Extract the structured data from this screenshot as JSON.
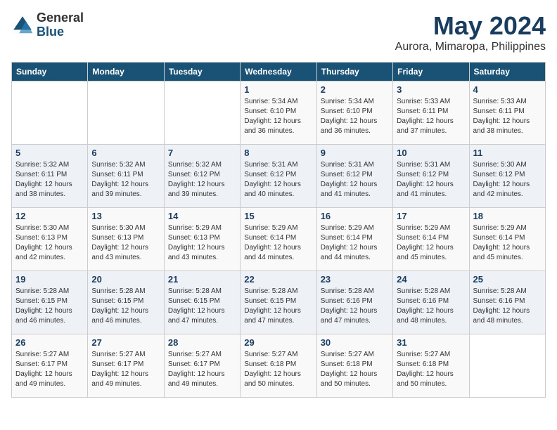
{
  "header": {
    "logo_general": "General",
    "logo_blue": "Blue",
    "title": "May 2024",
    "location": "Aurora, Mimaropa, Philippines"
  },
  "calendar": {
    "days_of_week": [
      "Sunday",
      "Monday",
      "Tuesday",
      "Wednesday",
      "Thursday",
      "Friday",
      "Saturday"
    ],
    "weeks": [
      [
        {
          "day": "",
          "info": ""
        },
        {
          "day": "",
          "info": ""
        },
        {
          "day": "",
          "info": ""
        },
        {
          "day": "1",
          "info": "Sunrise: 5:34 AM\nSunset: 6:10 PM\nDaylight: 12 hours\nand 36 minutes."
        },
        {
          "day": "2",
          "info": "Sunrise: 5:34 AM\nSunset: 6:10 PM\nDaylight: 12 hours\nand 36 minutes."
        },
        {
          "day": "3",
          "info": "Sunrise: 5:33 AM\nSunset: 6:11 PM\nDaylight: 12 hours\nand 37 minutes."
        },
        {
          "day": "4",
          "info": "Sunrise: 5:33 AM\nSunset: 6:11 PM\nDaylight: 12 hours\nand 38 minutes."
        }
      ],
      [
        {
          "day": "5",
          "info": "Sunrise: 5:32 AM\nSunset: 6:11 PM\nDaylight: 12 hours\nand 38 minutes."
        },
        {
          "day": "6",
          "info": "Sunrise: 5:32 AM\nSunset: 6:11 PM\nDaylight: 12 hours\nand 39 minutes."
        },
        {
          "day": "7",
          "info": "Sunrise: 5:32 AM\nSunset: 6:12 PM\nDaylight: 12 hours\nand 39 minutes."
        },
        {
          "day": "8",
          "info": "Sunrise: 5:31 AM\nSunset: 6:12 PM\nDaylight: 12 hours\nand 40 minutes."
        },
        {
          "day": "9",
          "info": "Sunrise: 5:31 AM\nSunset: 6:12 PM\nDaylight: 12 hours\nand 41 minutes."
        },
        {
          "day": "10",
          "info": "Sunrise: 5:31 AM\nSunset: 6:12 PM\nDaylight: 12 hours\nand 41 minutes."
        },
        {
          "day": "11",
          "info": "Sunrise: 5:30 AM\nSunset: 6:12 PM\nDaylight: 12 hours\nand 42 minutes."
        }
      ],
      [
        {
          "day": "12",
          "info": "Sunrise: 5:30 AM\nSunset: 6:13 PM\nDaylight: 12 hours\nand 42 minutes."
        },
        {
          "day": "13",
          "info": "Sunrise: 5:30 AM\nSunset: 6:13 PM\nDaylight: 12 hours\nand 43 minutes."
        },
        {
          "day": "14",
          "info": "Sunrise: 5:29 AM\nSunset: 6:13 PM\nDaylight: 12 hours\nand 43 minutes."
        },
        {
          "day": "15",
          "info": "Sunrise: 5:29 AM\nSunset: 6:14 PM\nDaylight: 12 hours\nand 44 minutes."
        },
        {
          "day": "16",
          "info": "Sunrise: 5:29 AM\nSunset: 6:14 PM\nDaylight: 12 hours\nand 44 minutes."
        },
        {
          "day": "17",
          "info": "Sunrise: 5:29 AM\nSunset: 6:14 PM\nDaylight: 12 hours\nand 45 minutes."
        },
        {
          "day": "18",
          "info": "Sunrise: 5:29 AM\nSunset: 6:14 PM\nDaylight: 12 hours\nand 45 minutes."
        }
      ],
      [
        {
          "day": "19",
          "info": "Sunrise: 5:28 AM\nSunset: 6:15 PM\nDaylight: 12 hours\nand 46 minutes."
        },
        {
          "day": "20",
          "info": "Sunrise: 5:28 AM\nSunset: 6:15 PM\nDaylight: 12 hours\nand 46 minutes."
        },
        {
          "day": "21",
          "info": "Sunrise: 5:28 AM\nSunset: 6:15 PM\nDaylight: 12 hours\nand 47 minutes."
        },
        {
          "day": "22",
          "info": "Sunrise: 5:28 AM\nSunset: 6:15 PM\nDaylight: 12 hours\nand 47 minutes."
        },
        {
          "day": "23",
          "info": "Sunrise: 5:28 AM\nSunset: 6:16 PM\nDaylight: 12 hours\nand 47 minutes."
        },
        {
          "day": "24",
          "info": "Sunrise: 5:28 AM\nSunset: 6:16 PM\nDaylight: 12 hours\nand 48 minutes."
        },
        {
          "day": "25",
          "info": "Sunrise: 5:28 AM\nSunset: 6:16 PM\nDaylight: 12 hours\nand 48 minutes."
        }
      ],
      [
        {
          "day": "26",
          "info": "Sunrise: 5:27 AM\nSunset: 6:17 PM\nDaylight: 12 hours\nand 49 minutes."
        },
        {
          "day": "27",
          "info": "Sunrise: 5:27 AM\nSunset: 6:17 PM\nDaylight: 12 hours\nand 49 minutes."
        },
        {
          "day": "28",
          "info": "Sunrise: 5:27 AM\nSunset: 6:17 PM\nDaylight: 12 hours\nand 49 minutes."
        },
        {
          "day": "29",
          "info": "Sunrise: 5:27 AM\nSunset: 6:18 PM\nDaylight: 12 hours\nand 50 minutes."
        },
        {
          "day": "30",
          "info": "Sunrise: 5:27 AM\nSunset: 6:18 PM\nDaylight: 12 hours\nand 50 minutes."
        },
        {
          "day": "31",
          "info": "Sunrise: 5:27 AM\nSunset: 6:18 PM\nDaylight: 12 hours\nand 50 minutes."
        },
        {
          "day": "",
          "info": ""
        }
      ]
    ]
  }
}
